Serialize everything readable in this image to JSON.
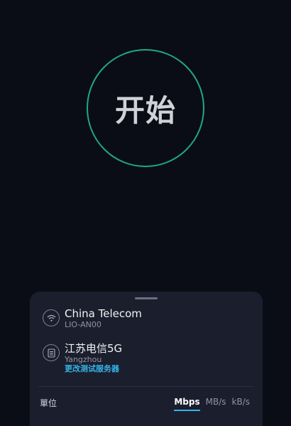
{
  "start": {
    "label": "开始"
  },
  "network": {
    "name": "China Telecom",
    "device": "LIO-AN00",
    "icon": "wifi-icon"
  },
  "server": {
    "name": "江苏电信5G",
    "city": "Yangzhou",
    "change_link": "更改测试服务器",
    "icon": "server-icon"
  },
  "units": {
    "label": "單位",
    "options": [
      "Mbps",
      "MB/s",
      "kB/s"
    ],
    "selected": "Mbps"
  },
  "colors": {
    "background": "#0b0d16",
    "accent_ring": "#1fa888",
    "link": "#34b3e8",
    "sheet": "#1b1e2d"
  }
}
